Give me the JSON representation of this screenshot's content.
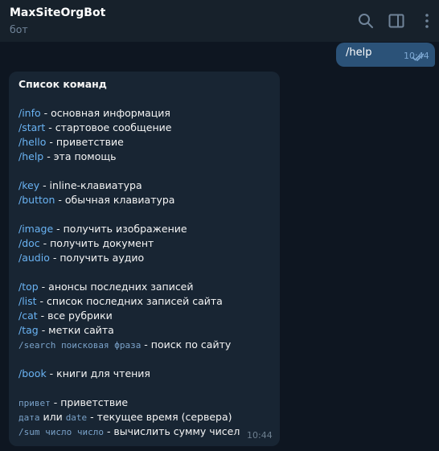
{
  "header": {
    "title": "MaxSiteOrgBot",
    "subtitle": "бот",
    "icons": [
      "search-icon",
      "sidebar-toggle-icon",
      "more-vertical-icon"
    ]
  },
  "outgoing": {
    "text": "/help",
    "time": "10:44",
    "status": "read"
  },
  "incoming": {
    "time": "10:44",
    "heading": "Список команд",
    "groups": [
      [
        {
          "cmd": "/info",
          "desc": " - основная информация"
        },
        {
          "cmd": "/start",
          "desc": " - стартовое сообщение"
        },
        {
          "cmd": "/hello",
          "desc": " - приветствие"
        },
        {
          "cmd": "/help",
          "desc": " - эта помощь"
        }
      ],
      [
        {
          "cmd": "/key",
          "desc": " - inline-клавиатура"
        },
        {
          "cmd": "/button",
          "desc": " - обычная клавиатура"
        }
      ],
      [
        {
          "cmd": "/image",
          "desc": " - получить изображение"
        },
        {
          "cmd": "/doc",
          "desc": " - получить документ"
        },
        {
          "cmd": "/audio",
          "desc": " - получить аудио"
        }
      ],
      [
        {
          "cmd": "/top",
          "desc": " - анонсы последних записей"
        },
        {
          "cmd": "/list",
          "desc": " - список последних записей сайта"
        },
        {
          "cmd": "/cat",
          "desc": " - все рубрики"
        },
        {
          "cmd": "/tag",
          "desc": " - метки сайта"
        },
        {
          "code": "/search поисковая фраза",
          "desc": " - поиск по сайту"
        }
      ],
      [
        {
          "cmd": "/book",
          "desc": " - книги для чтения"
        }
      ],
      [
        {
          "code": "привет",
          "desc": " - приветствие"
        },
        {
          "code": "дата",
          "mid": " или ",
          "code2": "date",
          "desc": " - текущее время (сервера)"
        },
        {
          "code": "/sum число число",
          "desc": " - вычислить сумму чисел"
        }
      ]
    ]
  },
  "colors": {
    "background": "#0e1621",
    "header": "#17212b",
    "incoming_bubble": "#182533",
    "outgoing_bubble": "#2b5278",
    "link": "#6ab3f3"
  }
}
